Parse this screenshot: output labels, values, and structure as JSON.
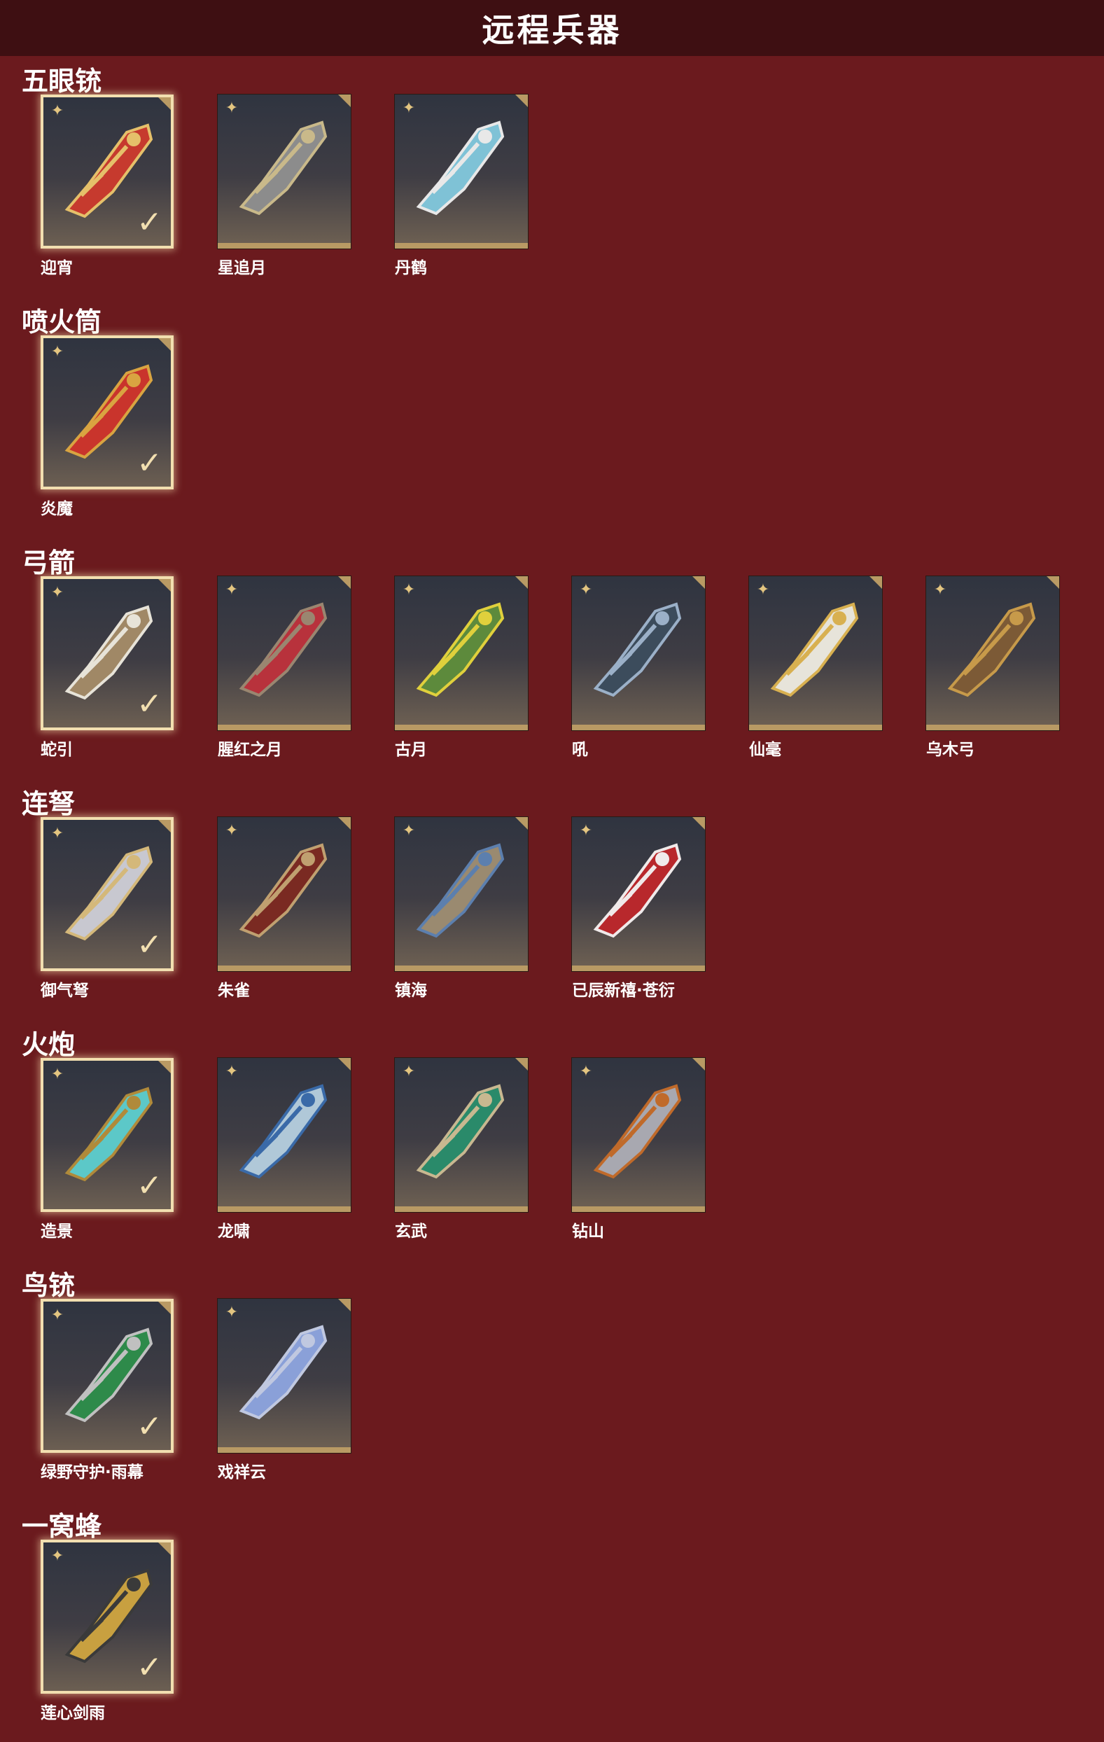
{
  "header": {
    "title": "远程兵器"
  },
  "icons": {
    "star": "four-point-star-icon",
    "check": "checkmark-icon",
    "corner": "corner-tab-icon"
  },
  "colors": {
    "background": "#6b1a1e",
    "header": "#3e0f12",
    "accent": "#b99a64",
    "highlight": "#f2dfb0"
  },
  "sections": [
    {
      "title": "五眼铳",
      "items": [
        {
          "label": "迎宵",
          "selected": true
        },
        {
          "label": "星追月",
          "selected": false
        },
        {
          "label": "丹鹤",
          "selected": false
        }
      ]
    },
    {
      "title": "喷火筒",
      "items": [
        {
          "label": "炎魔",
          "selected": true
        }
      ]
    },
    {
      "title": "弓箭",
      "items": [
        {
          "label": "蛇引",
          "selected": true
        },
        {
          "label": "腥红之月",
          "selected": false
        },
        {
          "label": "古月",
          "selected": false
        },
        {
          "label": "吼",
          "selected": false
        },
        {
          "label": "仙毫",
          "selected": false
        },
        {
          "label": "乌木弓",
          "selected": false
        }
      ]
    },
    {
      "title": "连弩",
      "items": [
        {
          "label": "御气弩",
          "selected": true
        },
        {
          "label": "朱雀",
          "selected": false
        },
        {
          "label": "镇海",
          "selected": false
        },
        {
          "label": "已辰新禧·苍衍",
          "selected": false
        }
      ]
    },
    {
      "title": "火炮",
      "items": [
        {
          "label": "造景",
          "selected": true
        },
        {
          "label": "龙啸",
          "selected": false
        },
        {
          "label": "玄武",
          "selected": false
        },
        {
          "label": "钻山",
          "selected": false
        }
      ]
    },
    {
      "title": "鸟铳",
      "items": [
        {
          "label": "绿野守护·雨幕",
          "selected": true
        },
        {
          "label": "戏祥云",
          "selected": false
        }
      ]
    },
    {
      "title": "一窝蜂",
      "items": [
        {
          "label": "莲心剑雨",
          "selected": true
        }
      ]
    }
  ]
}
